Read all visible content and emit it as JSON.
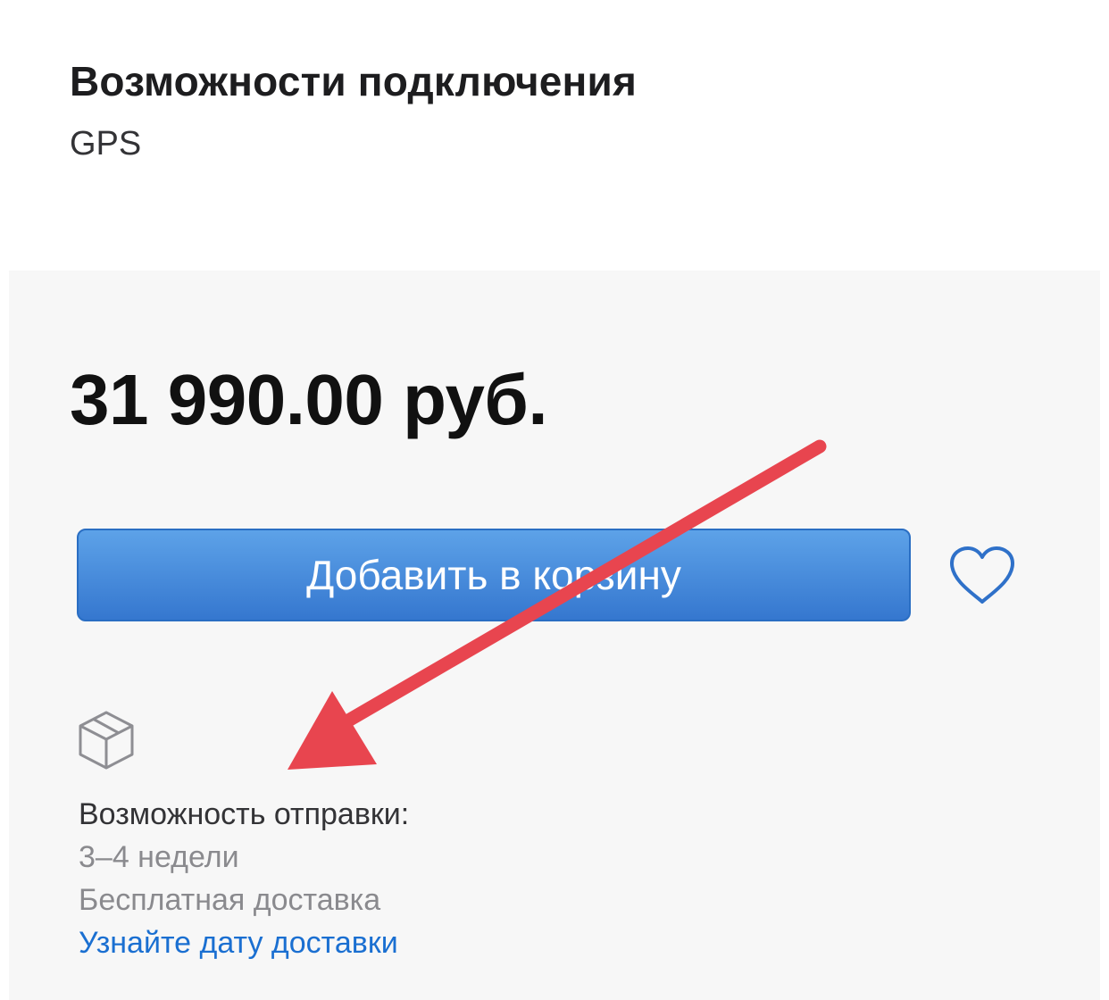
{
  "connectivity": {
    "title": "Возможности подключения",
    "value": "GPS"
  },
  "purchase": {
    "price": "31 990.00 руб.",
    "add_to_cart_label": "Добавить в корзину",
    "favorite_icon": "heart-outline-icon"
  },
  "shipping": {
    "icon": "box-icon",
    "label": "Возможность отправки:",
    "time": "3–4 недели",
    "free_delivery": "Бесплатная доставка",
    "link": "Узнайте дату доставки"
  },
  "annotation": {
    "icon": "red-arrow-annotation",
    "color": "#e8454f"
  },
  "colors": {
    "button_top": "#5da2e8",
    "button_bottom": "#3577cf",
    "link": "#1a6fd1",
    "panel_bg": "#f7f7f7"
  }
}
